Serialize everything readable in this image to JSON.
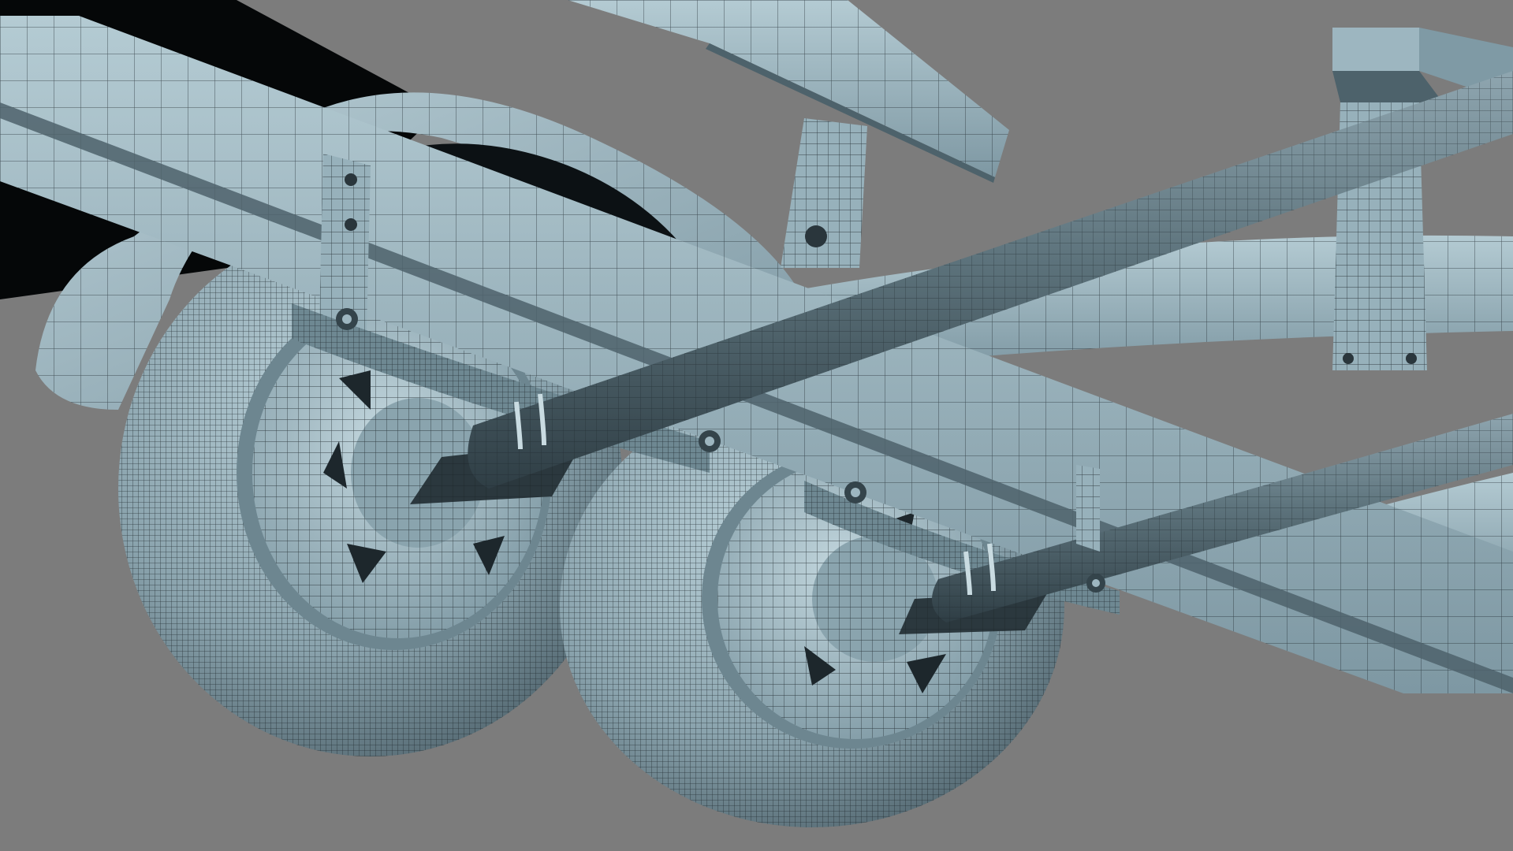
{
  "scene": {
    "subject": "boat-trailer-undercarriage",
    "render_style": "wireframe-on-shaded",
    "colors": {
      "background": "#7c7c7c",
      "surface_light": "#a9c3cd",
      "surface_mid": "#7f9aa5",
      "surface_dark": "#4d626b",
      "shadow": "#26323a",
      "wire": "#1b2429"
    },
    "components": {
      "wheels": 2,
      "axles": 2,
      "leaf_spring_packs": 2,
      "frame_rails": 2,
      "bunk_boards": 2,
      "fenders": 1
    }
  }
}
